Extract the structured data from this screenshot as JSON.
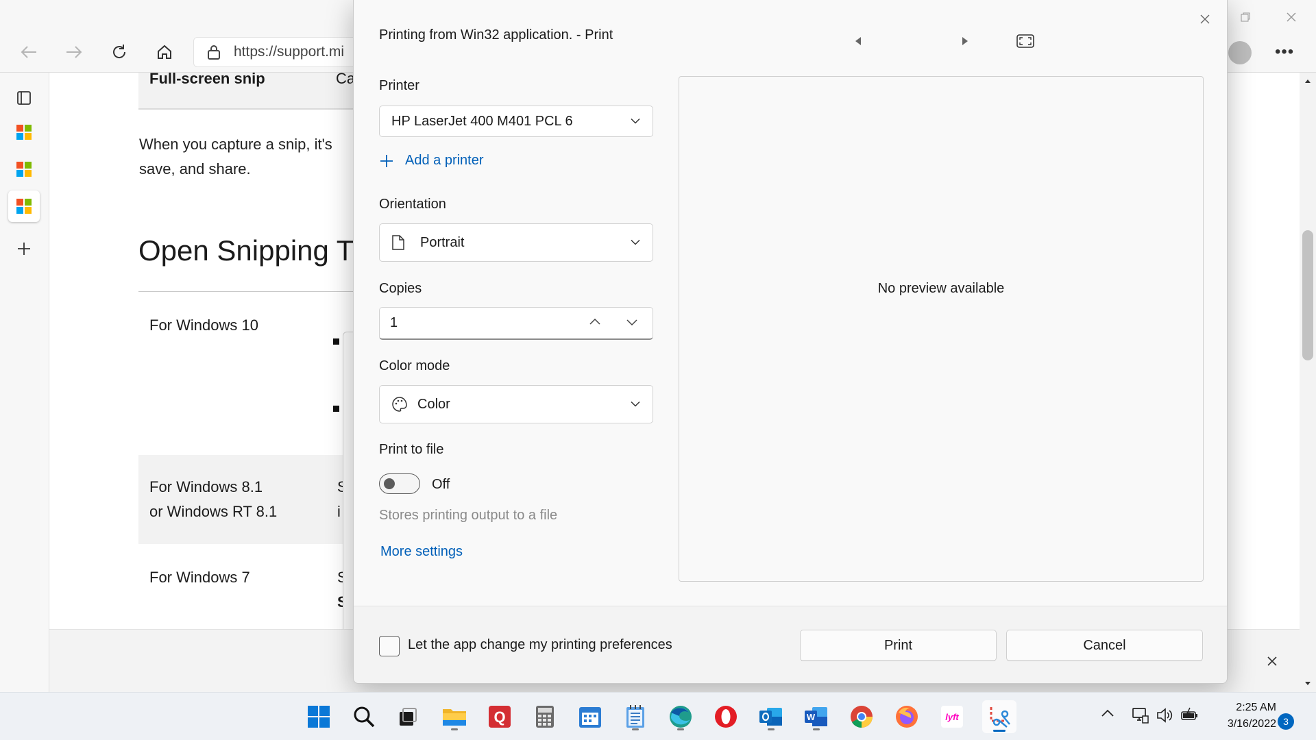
{
  "browser": {
    "address_text": "https://support.mi",
    "sidebar_items": [
      "tabs-icon",
      "microsoft-logo-icon",
      "microsoft-logo-icon",
      "microsoft-logo-icon",
      "add-icon"
    ]
  },
  "page": {
    "table_header_cell": "Full-screen snip",
    "table_header_cell_2": "Ca",
    "intro_line1": "When you capture a snip, it's",
    "intro_line2": "save, and share.",
    "section_heading": "Open Snipping T",
    "rows": [
      {
        "label_line1": "For Windows 10",
        "label_line2": "",
        "col2": ""
      },
      {
        "label_line1": "For Windows 8.1",
        "label_line2": "or Windows RT 8.1",
        "col2_line1": "S",
        "col2_line2": "i"
      },
      {
        "label_line1": "For Windows 7",
        "label_line2": "",
        "col2_line1": "S",
        "col2_line2": "S"
      }
    ]
  },
  "dialog": {
    "title": "Printing from Win32 application. - Print",
    "printer_label": "Printer",
    "printer_value": "HP LaserJet 400 M401 PCL 6",
    "add_printer": "Add a printer",
    "orientation_label": "Orientation",
    "orientation_value": "Portrait",
    "copies_label": "Copies",
    "copies_value": "1",
    "color_mode_label": "Color mode",
    "color_mode_value": "Color",
    "print_to_file_label": "Print to file",
    "toggle_state": "Off",
    "toggle_help": "Stores printing output to a file",
    "more_settings": "More settings",
    "preview_text": "No preview available",
    "checkbox_label": "Let the app change my printing preferences",
    "print_button": "Print",
    "cancel_button": "Cancel"
  },
  "taskbar": {
    "apps": [
      "windows-start",
      "search",
      "task-view",
      "file-explorer",
      "quickbooks",
      "calculator",
      "outlook-calendar",
      "notepad",
      "edge",
      "opera",
      "outlook",
      "word",
      "chrome",
      "firefox",
      "lyft",
      "snipping-tool"
    ],
    "time": "2:25 AM",
    "date": "3/16/2022",
    "notification_count": "3"
  },
  "colors": {
    "accent": "#005fb8",
    "dialog_bg": "#f9f9f9",
    "taskbar_bg": "#eef1f5"
  }
}
